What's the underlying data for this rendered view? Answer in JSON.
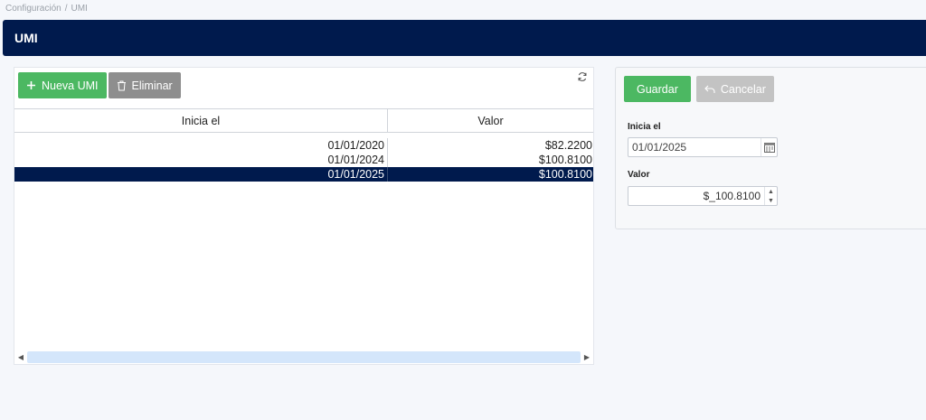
{
  "breadcrumb": {
    "parent": "Configuración",
    "separator": "/",
    "current": "UMI"
  },
  "header": {
    "title": "UMI"
  },
  "toolbar": {
    "new_label": "Nueva UMI",
    "delete_label": "Eliminar"
  },
  "grid": {
    "columns": [
      "Inicia el",
      "Valor"
    ],
    "rows": [
      {
        "date": "01/01/2020",
        "value": "$82.2200"
      },
      {
        "date": "01/01/2024",
        "value": "$100.8100"
      },
      {
        "date": "01/01/2025",
        "value": "$100.8100",
        "selected": true
      }
    ]
  },
  "form": {
    "save_label": "Guardar",
    "cancel_label": "Cancelar",
    "start_label": "Inicia el",
    "start_value": "01/01/2025",
    "value_label": "Valor",
    "value_value": "$_100.8100"
  },
  "colors": {
    "header_bg": "#001a4d",
    "green": "#4cb862",
    "gray": "#8e8e8e",
    "selected_row": "#001a4d"
  },
  "icons": [
    "plus-icon",
    "trash-icon",
    "refresh-icon",
    "undo-icon",
    "calendar-icon",
    "spinner-up-icon",
    "spinner-down-icon"
  ]
}
